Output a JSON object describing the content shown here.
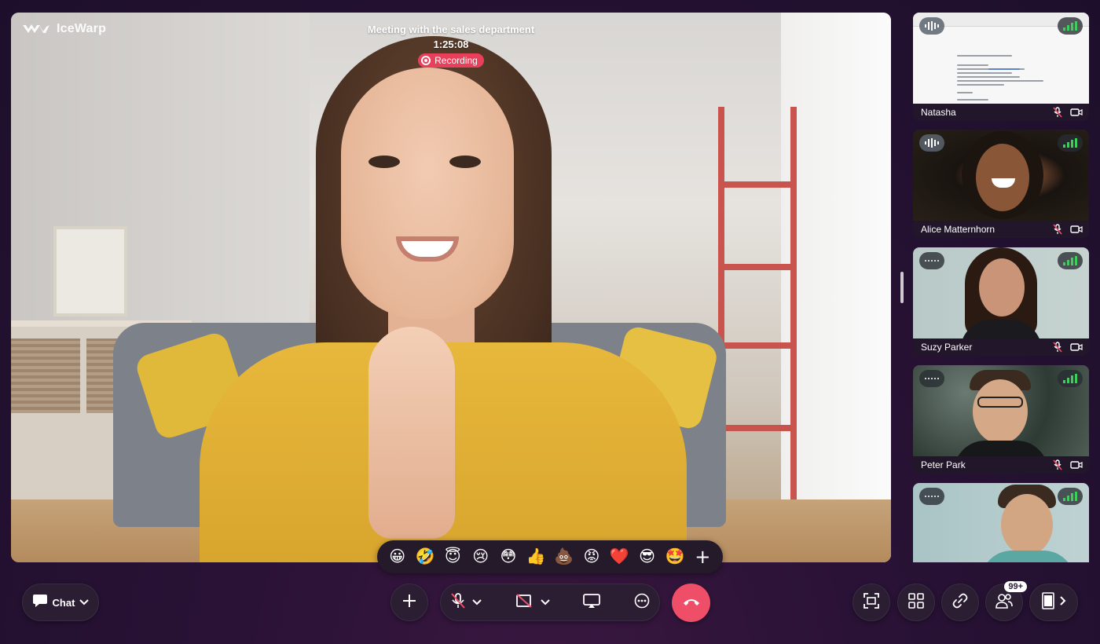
{
  "app": {
    "brand": "IceWarp"
  },
  "meeting": {
    "title": "Meeting with the sales department",
    "elapsed": "1:25:08",
    "recording_label": "Recording"
  },
  "reactions": [
    "😀",
    "🤣",
    "😇",
    "😢",
    "😳",
    "👍",
    "💩",
    "😡",
    "❤️",
    "😎",
    "🤩"
  ],
  "participants": [
    {
      "name": "Natasha",
      "mic": "muted",
      "camera": "on",
      "speaking": true,
      "signal": "full",
      "content": "shared-document"
    },
    {
      "name": "Alice Matternhorn",
      "mic": "muted",
      "camera": "on",
      "speaking": true,
      "signal": "full"
    },
    {
      "name": "Suzy Parker",
      "mic": "muted",
      "camera": "on",
      "speaking": false,
      "signal": "full"
    },
    {
      "name": "Peter Park",
      "mic": "muted",
      "camera": "on",
      "speaking": false,
      "signal": "full"
    },
    {
      "name": "",
      "mic": "muted",
      "camera": "on",
      "speaking": false,
      "signal": "full"
    }
  ],
  "controls": {
    "chat_label": "Chat",
    "participants_badge": "99+",
    "mic": "muted",
    "camera": "off"
  },
  "colors": {
    "accent_red": "#ee4e67",
    "recording_red": "#e8405a",
    "signal_green": "#3ecf5a",
    "background": "#2a1236"
  },
  "icons": [
    "chat-bubble-icon",
    "chevron-down-icon",
    "plus-icon",
    "mic-off-icon",
    "camera-off-icon",
    "screen-share-icon",
    "more-icon",
    "hang-up-icon",
    "fullscreen-icon",
    "grid-icon",
    "link-icon",
    "participants-icon",
    "sidebar-icon",
    "chevron-right-icon",
    "speaking-wave-icon",
    "signal-bars-icon"
  ]
}
